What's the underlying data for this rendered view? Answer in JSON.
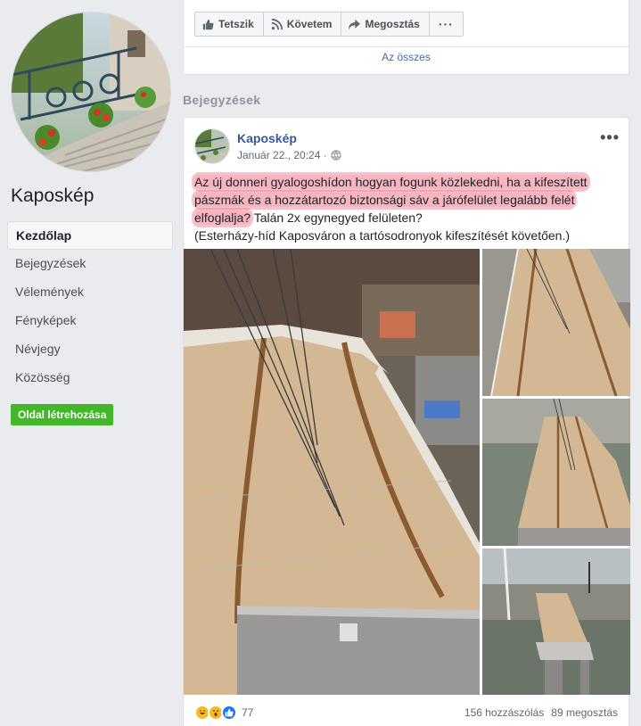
{
  "sidebar": {
    "page_name": "Kaposkép",
    "nav": [
      {
        "label": "Kezdőlap",
        "active": true
      },
      {
        "label": "Bejegyzések"
      },
      {
        "label": "Vélemények"
      },
      {
        "label": "Fényképek"
      },
      {
        "label": "Névjegy"
      },
      {
        "label": "Közösség"
      }
    ],
    "create_page_label": "Oldal létrehozása"
  },
  "top_card": {
    "actions": [
      {
        "label": "Tetszik",
        "icon": "thumbs-up-icon"
      },
      {
        "label": "Követem",
        "icon": "rss-icon"
      },
      {
        "label": "Megosztás",
        "icon": "share-arrow-icon"
      },
      {
        "label": "",
        "icon": "more-dots-icon"
      }
    ],
    "more_label": "···",
    "all_link": "Az összes"
  },
  "section_title": "Bejegyzések",
  "post": {
    "author": "Kaposkép",
    "timestamp": "Január 22., 20:24 ·",
    "privacy_icon": "globe-icon",
    "menu_label": "•••",
    "text_line1_highlight": "Az új donneri gyalogoshídon hogyan fogunk közlekedni, ha a kifeszített",
    "text_line2_highlight": "pászmák és a hozzátartozó biztonsági sáv a járófelület legalább felét",
    "text_line3_highlight": "elfoglalja?",
    "text_line3_rest": " Talán 2x egynegyed felületen?",
    "text_line4": "(Esterházy-híd Kaposváron a tartósodronyok kifeszítését követően.)",
    "reaction_icons": [
      "haha-icon",
      "wow-icon",
      "like-icon"
    ],
    "reaction_count": "77",
    "comments": "156 hozzászólás",
    "shares": "89 megosztás"
  },
  "colors": {
    "link": "#365899",
    "accent_green": "#42b72a",
    "highlight": "#f0788c"
  }
}
